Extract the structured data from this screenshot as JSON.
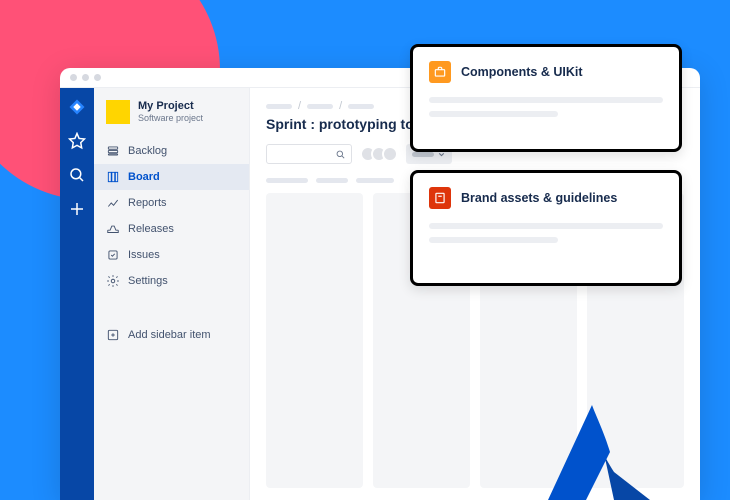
{
  "project": {
    "name": "My Project",
    "subtitle": "Software project"
  },
  "sidebar": {
    "items": [
      {
        "label": "Backlog"
      },
      {
        "label": "Board"
      },
      {
        "label": "Reports"
      },
      {
        "label": "Releases"
      },
      {
        "label": "Issues"
      },
      {
        "label": "Settings"
      }
    ],
    "add_label": "Add sidebar item"
  },
  "page": {
    "title": "Sprint : prototyping tool"
  },
  "cards": {
    "components": {
      "title": "Components & UIKit"
    },
    "brand": {
      "title": "Brand assets & guidelines"
    }
  }
}
